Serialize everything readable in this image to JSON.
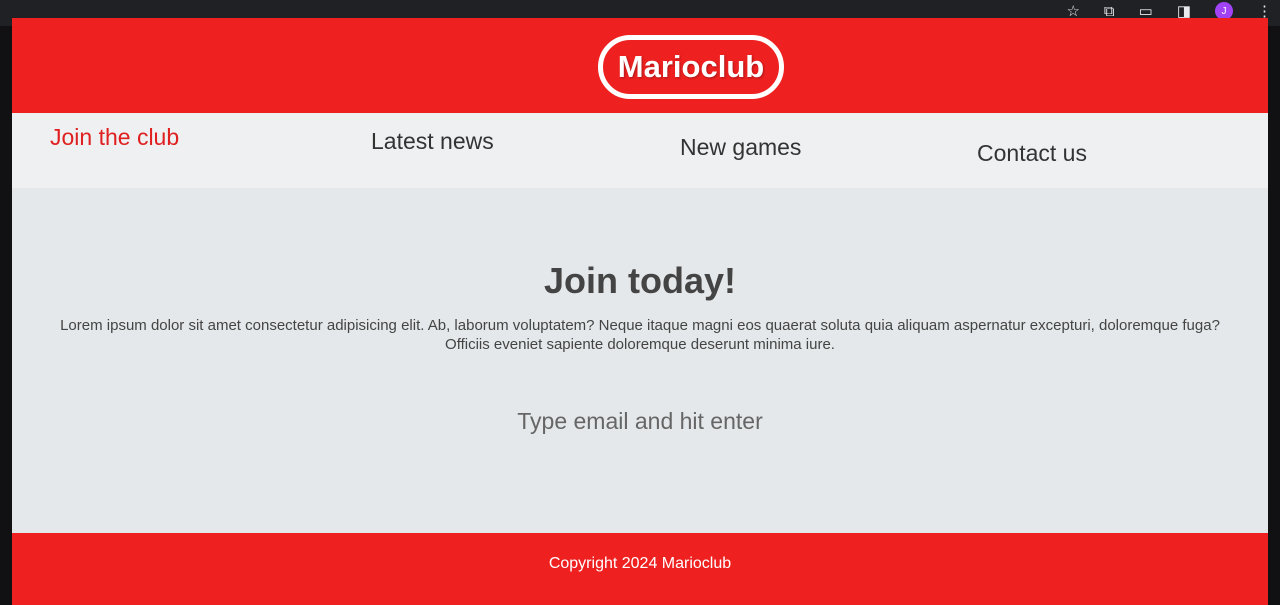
{
  "browser": {
    "icons": [
      "bookmark-star-icon",
      "extensions-icon",
      "cast-icon",
      "side-panel-icon",
      "more-menu-icon"
    ],
    "profile_initial": "J",
    "star_glyph": "☆",
    "extensions_glyph": "⧉",
    "cast_glyph": "▭",
    "sidepanel_glyph": "◨",
    "menu_glyph": "⋮"
  },
  "header": {
    "logo": "Marioclub",
    "background": "#ef2020"
  },
  "nav": {
    "items": [
      {
        "label": "Join the club",
        "active": true
      },
      {
        "label": "Latest news",
        "active": false
      },
      {
        "label": "New games",
        "active": false
      },
      {
        "label": "Contact us",
        "active": false
      }
    ]
  },
  "main": {
    "title": "Join today!",
    "text": "Lorem ipsum dolor sit amet consectetur adipisicing elit. Ab, laborum voluptatem? Neque itaque magni eos quaerat soluta quia aliquam aspernatur excepturi, doloremque fuga? Officiis eveniet sapiente doloremque deserunt minima iure.",
    "email_placeholder": "Type email and hit enter",
    "email_value": ""
  },
  "footer": {
    "copyright": "Copyright 2024 Marioclub"
  },
  "colors": {
    "brand_red": "#ef2020",
    "active_link": "#e02020"
  }
}
